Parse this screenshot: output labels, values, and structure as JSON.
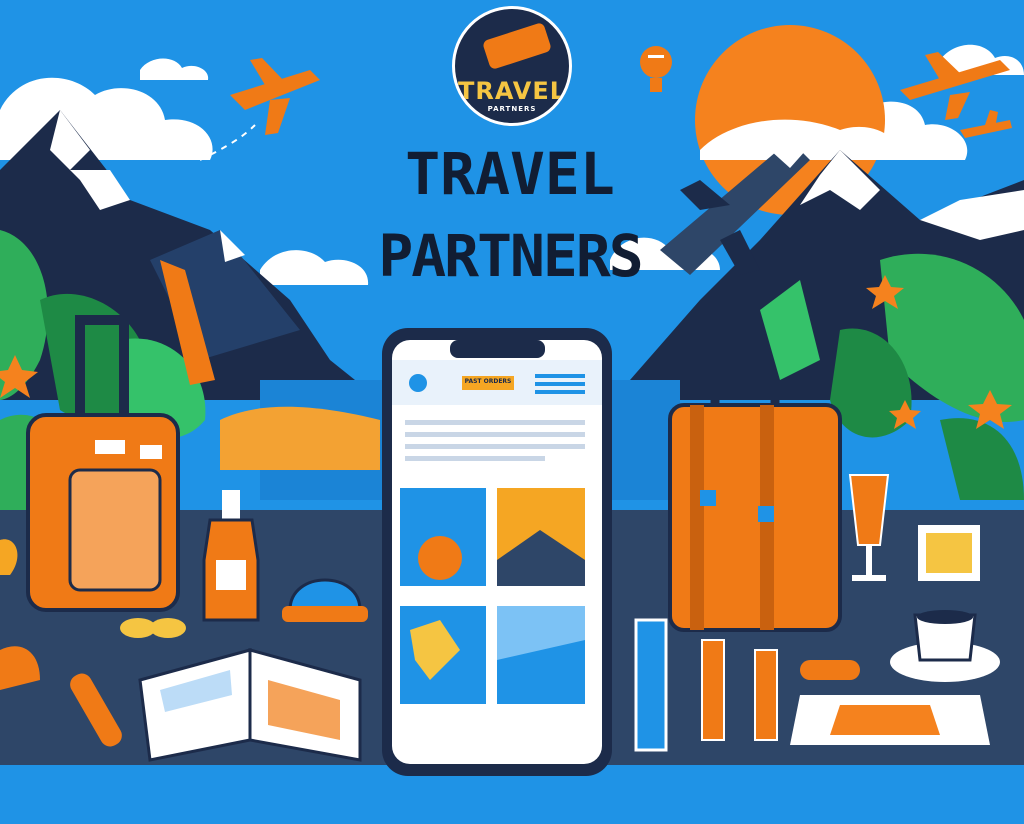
{
  "logo": {
    "name": "TRAVEL",
    "tagline": "PARTNERS"
  },
  "headline": {
    "line1": "TRAVEL",
    "line2": "PARTNERS"
  },
  "phone": {
    "banner_text": "PAST ORDERS"
  },
  "colors": {
    "sky": "#1f93e6",
    "accent_orange": "#f07a16",
    "navy": "#1c2b4a",
    "leaf_green": "#2fae5a",
    "table": "#2e4668",
    "sun": "#f5821e"
  }
}
